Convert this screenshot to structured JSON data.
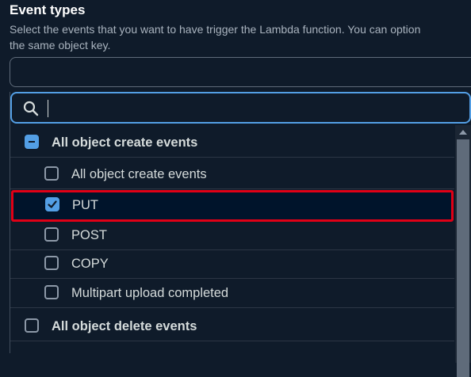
{
  "section": {
    "title": "Event types",
    "description_line1": "Select the events that you want to have trigger the Lambda function. You can option",
    "description_line2": "the same object key."
  },
  "search": {
    "placeholder": "",
    "value": ""
  },
  "options": [
    {
      "label": "All object create events",
      "kind": "group",
      "state": "indeterminate"
    },
    {
      "label": "All object create events",
      "kind": "item",
      "state": "unchecked"
    },
    {
      "label": "PUT",
      "kind": "item",
      "state": "checked",
      "highlighted": true
    },
    {
      "label": "POST",
      "kind": "item",
      "state": "unchecked"
    },
    {
      "label": "COPY",
      "kind": "item",
      "state": "unchecked"
    },
    {
      "label": "Multipart upload completed",
      "kind": "item",
      "state": "unchecked"
    },
    {
      "label": "All object delete events",
      "kind": "group",
      "state": "unchecked"
    }
  ],
  "colors": {
    "accent": "#539fe5",
    "highlight_border": "#e00016",
    "background": "#0f1b2a"
  },
  "icons": {
    "search": "search-icon",
    "checkmark": "checkmark-icon",
    "scroll_up": "chevron-up-icon"
  }
}
